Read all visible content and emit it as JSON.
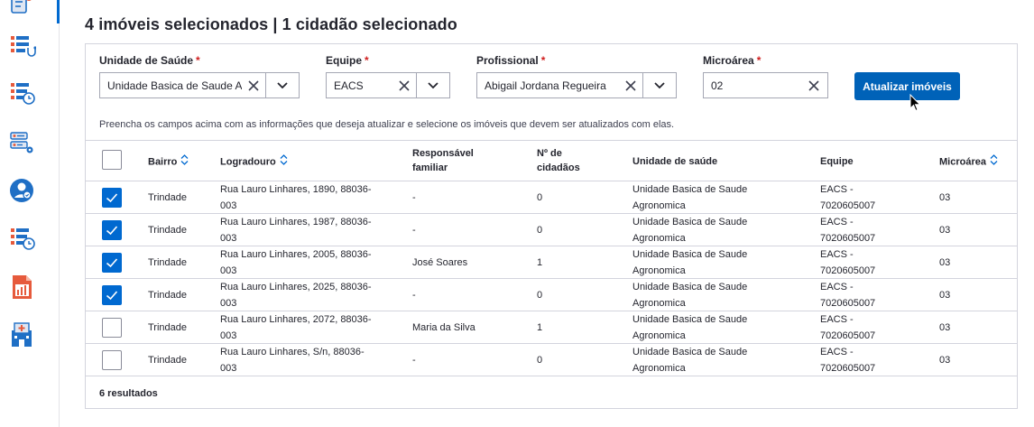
{
  "header": {
    "title": "4 imóveis selecionados | 1 cidadão selecionado"
  },
  "filters": {
    "unidade": {
      "label": "Unidade de Saúde",
      "required": "*",
      "value": "Unidade Basica de Saude Agronomica"
    },
    "equipe": {
      "label": "Equipe",
      "required": "*",
      "value": "EACS"
    },
    "profissional": {
      "label": "Profissional",
      "required": "*",
      "value": "Abigail Jordana Regueira"
    },
    "microarea": {
      "label": "Microárea",
      "required": "*",
      "value": "02"
    },
    "update_button": "Atualizar imóveis"
  },
  "hint": "Preencha os campos acima com as informações que deseja atualizar e selecione os imóveis que devem ser atualizados com elas.",
  "table": {
    "columns": {
      "bairro": "Bairro",
      "logradouro": "Logradouro",
      "responsavel_1": "Responsável",
      "responsavel_2": "familiar",
      "cidadaos_1": "Nº de",
      "cidadaos_2": "cidadãos",
      "unidade": "Unidade de saúde",
      "equipe": "Equipe",
      "microarea": "Microárea"
    },
    "rows": [
      {
        "checked": true,
        "bairro": "Trindade",
        "logradouro_1": "Rua Lauro Linhares, 1890, 88036-",
        "logradouro_2": "003",
        "responsavel": "-",
        "cidadaos": "0",
        "unidade_1": "Unidade Basica de Saude",
        "unidade_2": "Agronomica",
        "equipe_1": "EACS -",
        "equipe_2": "7020605007",
        "microarea": "03"
      },
      {
        "checked": true,
        "bairro": "Trindade",
        "logradouro_1": "Rua Lauro Linhares, 1987, 88036-",
        "logradouro_2": "003",
        "responsavel": "-",
        "cidadaos": "0",
        "unidade_1": "Unidade Basica de Saude",
        "unidade_2": "Agronomica",
        "equipe_1": "EACS -",
        "equipe_2": "7020605007",
        "microarea": "03"
      },
      {
        "checked": true,
        "bairro": "Trindade",
        "logradouro_1": "Rua Lauro Linhares, 2005, 88036-",
        "logradouro_2": "003",
        "responsavel": "José Soares",
        "cidadaos": "1",
        "unidade_1": "Unidade Basica de Saude",
        "unidade_2": "Agronomica",
        "equipe_1": "EACS -",
        "equipe_2": "7020605007",
        "microarea": "03"
      },
      {
        "checked": true,
        "bairro": "Trindade",
        "logradouro_1": "Rua Lauro Linhares, 2025, 88036-",
        "logradouro_2": "003",
        "responsavel": "-",
        "cidadaos": "0",
        "unidade_1": "Unidade Basica de Saude",
        "unidade_2": "Agronomica",
        "equipe_1": "EACS -",
        "equipe_2": "7020605007",
        "microarea": "03"
      },
      {
        "checked": false,
        "bairro": "Trindade",
        "logradouro_1": "Rua Lauro Linhares, 2072, 88036-",
        "logradouro_2": "003",
        "responsavel": "Maria da Silva",
        "cidadaos": "1",
        "unidade_1": "Unidade Basica de Saude",
        "unidade_2": "Agronomica",
        "equipe_1": "EACS -",
        "equipe_2": "7020605007",
        "microarea": "03"
      },
      {
        "checked": false,
        "bairro": "Trindade",
        "logradouro_1": "Rua Lauro Linhares, S/n, 88036-",
        "logradouro_2": "003",
        "responsavel": "-",
        "cidadaos": "0",
        "unidade_1": "Unidade Basica de Saude",
        "unidade_2": "Agronomica",
        "equipe_1": "EACS -",
        "equipe_2": "7020605007",
        "microarea": "03"
      }
    ]
  },
  "footer": {
    "count": "6 resultados"
  },
  "colors": {
    "primary": "#0062b8",
    "checkbox": "#0069d0",
    "required": "#d01e1e",
    "icon_red": "#e65a3c",
    "icon_blue": "#1f6fc5"
  }
}
